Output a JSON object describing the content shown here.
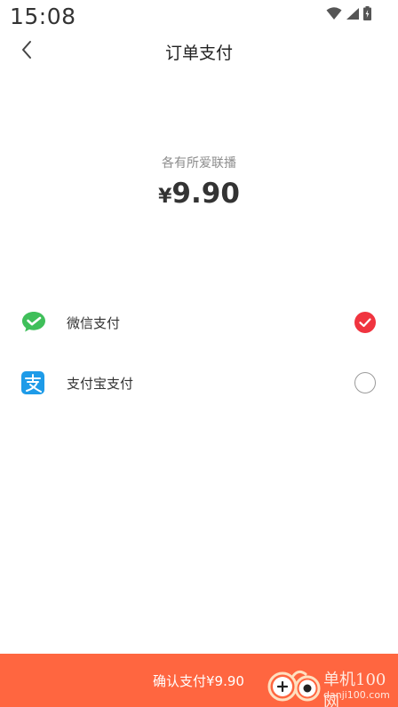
{
  "status_bar": {
    "time": "15:08",
    "icons": [
      "wifi-icon",
      "cellular-signal-icon",
      "battery-icon"
    ]
  },
  "nav": {
    "back_icon": "chevron-left-icon",
    "title": "订单支付"
  },
  "order": {
    "merchant": "各有所爱联播",
    "currency_symbol": "¥",
    "amount": "9.90"
  },
  "payment_methods": [
    {
      "label": "微信支付",
      "icon": "wechat-pay-icon",
      "selected": true,
      "color": "#3fbf5a"
    },
    {
      "label": "支付宝支付",
      "icon": "alipay-icon",
      "selected": false,
      "color": "#1e9be8"
    }
  ],
  "confirm": {
    "label": "确认支付¥9.90"
  },
  "watermark": {
    "name": "单机100网",
    "domain": "danji100.com"
  },
  "colors": {
    "accent": "#ff6640",
    "selected": "#f0343f",
    "wechat": "#3fbf5a",
    "alipay": "#1e9be8"
  }
}
